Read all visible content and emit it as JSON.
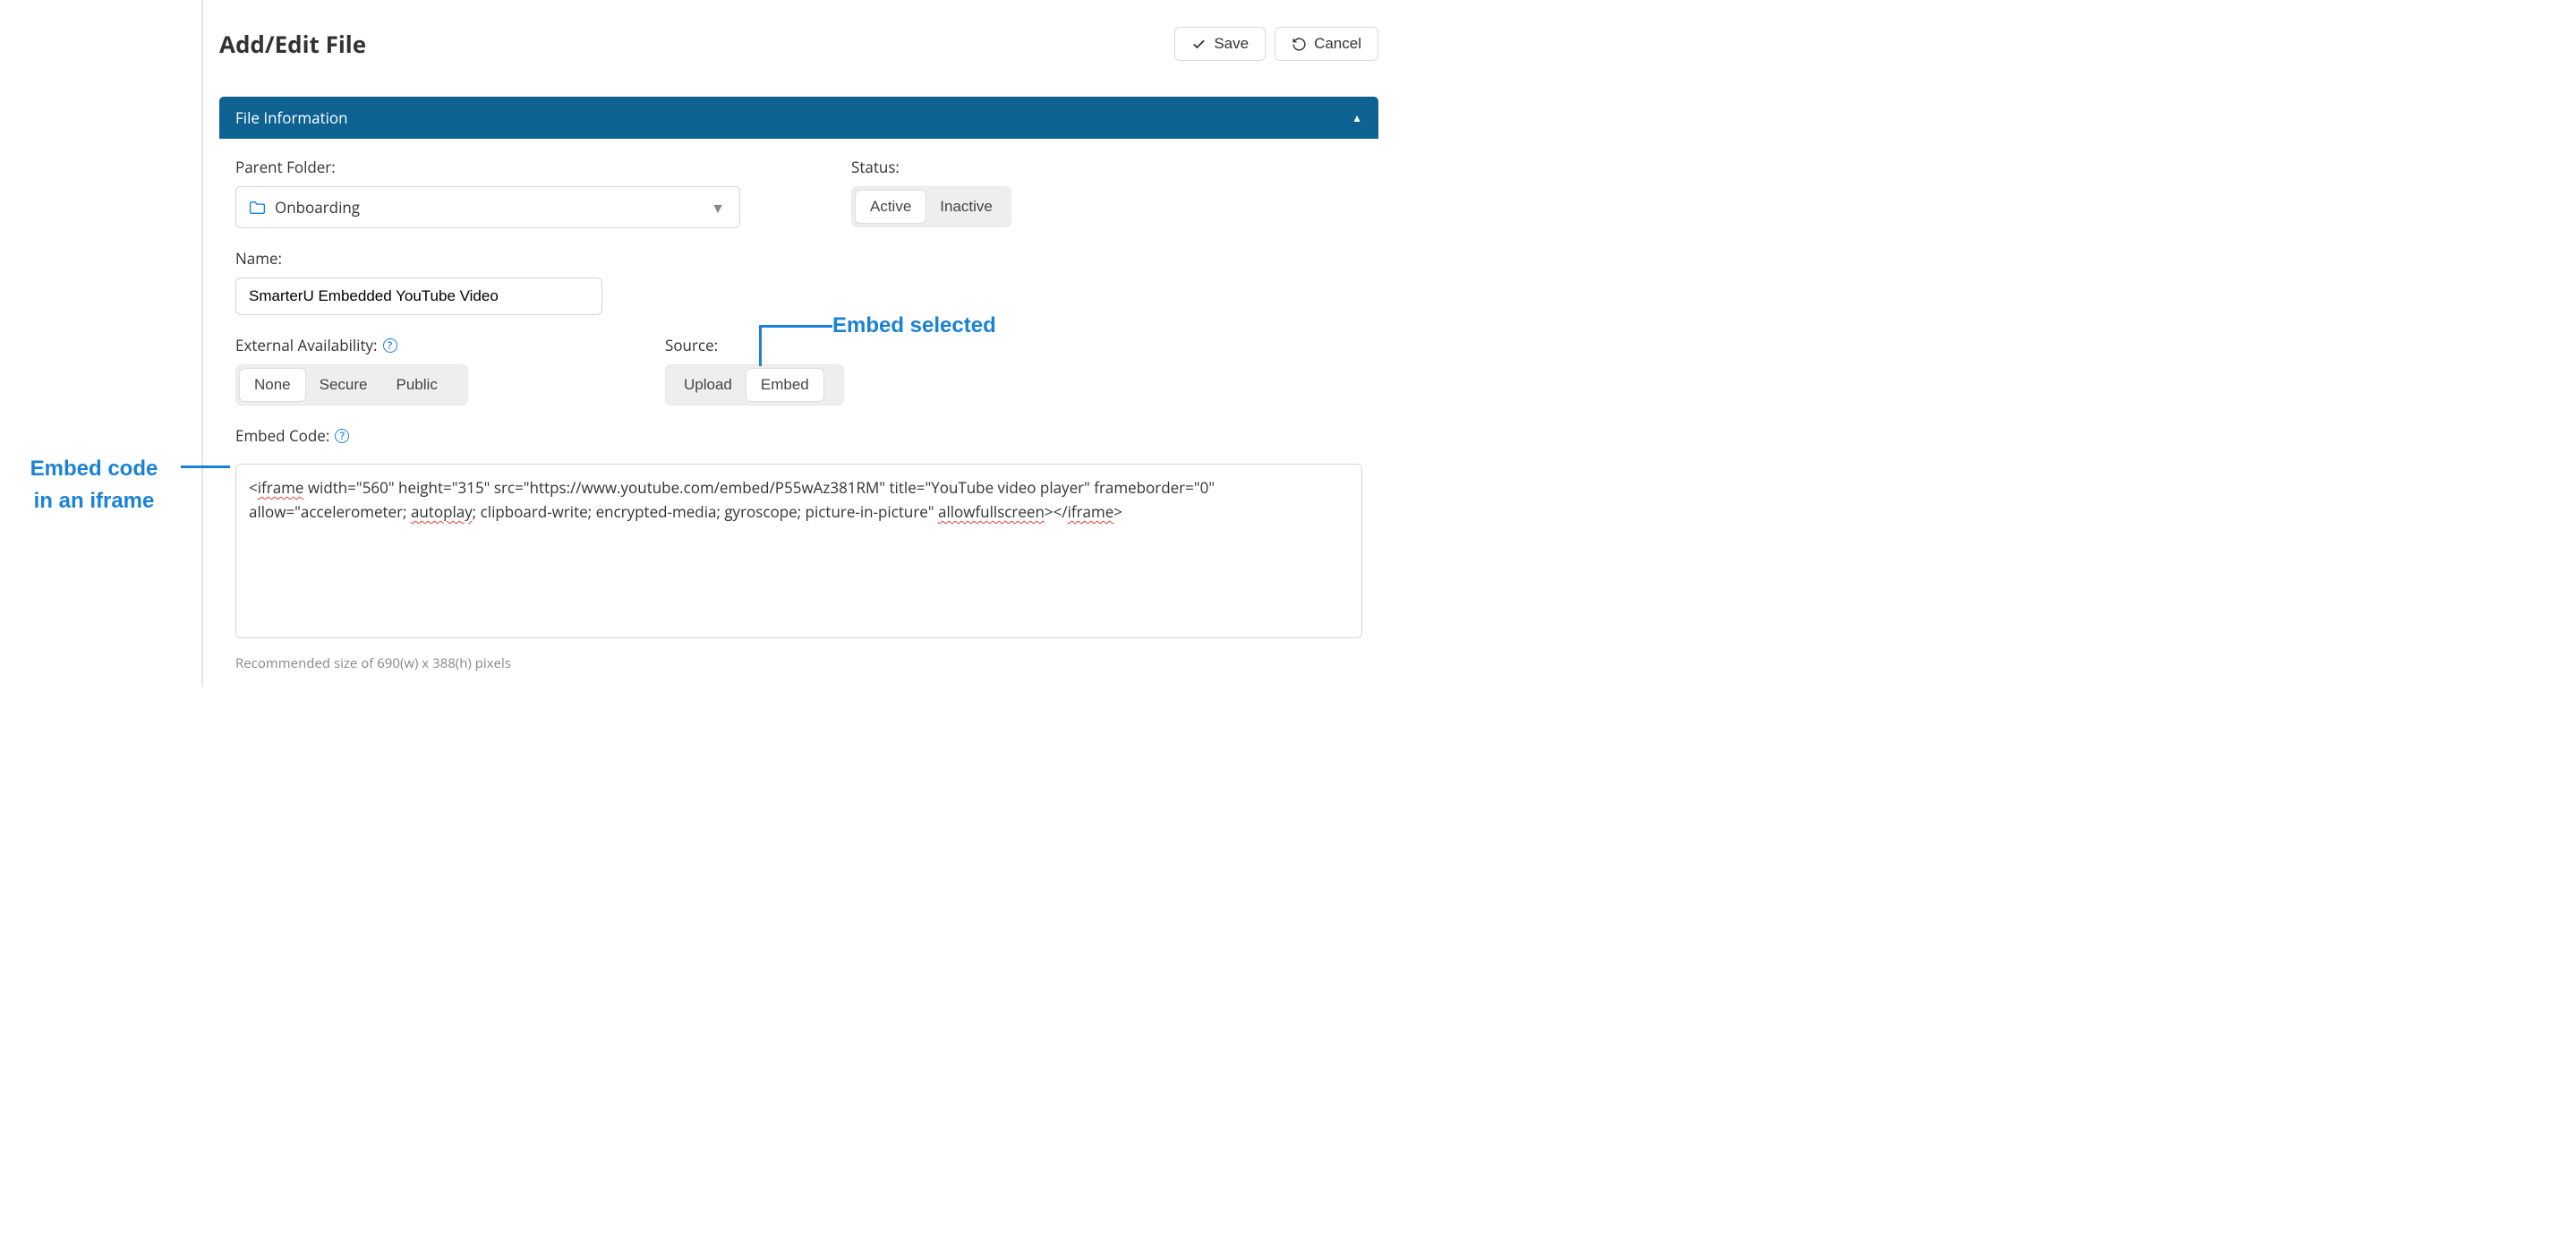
{
  "page": {
    "title": "Add/Edit File",
    "saveLabel": "Save",
    "cancelLabel": "Cancel"
  },
  "panel": {
    "title": "File Information"
  },
  "form": {
    "parentFolder": {
      "label": "Parent Folder:",
      "value": "Onboarding"
    },
    "status": {
      "label": "Status:",
      "options": [
        "Active",
        "Inactive"
      ],
      "selected": "Active"
    },
    "name": {
      "label": "Name:",
      "value": "SmarterU Embedded YouTube Video"
    },
    "external": {
      "label": "External Availability:",
      "options": [
        "None",
        "Secure",
        "Public"
      ],
      "selected": "None"
    },
    "source": {
      "label": "Source:",
      "options": [
        "Upload",
        "Embed"
      ],
      "selected": "Embed"
    },
    "embedCode": {
      "label": "Embed Code:",
      "value": "<iframe width=\"560\" height=\"315\" src=\"https://www.youtube.com/embed/P55wAz381RM\" title=\"YouTube video player\" frameborder=\"0\" allow=\"accelerometer; autoplay; clipboard-write; encrypted-media; gyroscope; picture-in-picture\" allowfullscreen></iframe>",
      "hint": "Recommended size of 690(w) x 388(h) pixels"
    }
  },
  "annotations": {
    "embedSelected": "Embed selected",
    "embedCodeLine1": "Embed code",
    "embedCodeLine2": "in an iframe"
  }
}
